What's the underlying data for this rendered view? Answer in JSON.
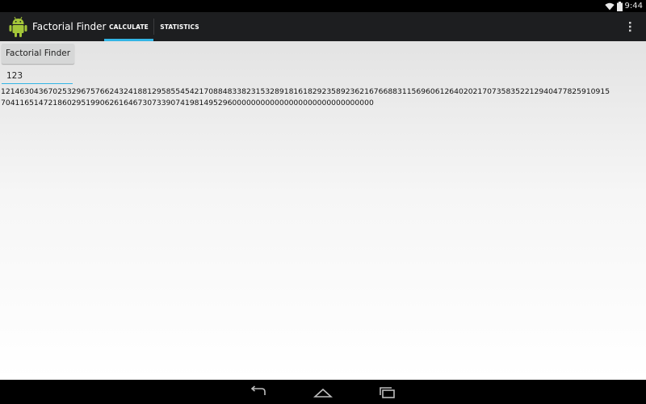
{
  "status_bar": {
    "time": "9:44",
    "icons": [
      "wifi-icon",
      "battery-icon"
    ]
  },
  "action_bar": {
    "app_title": "Factorial Finder",
    "app_icon": "android-icon",
    "tabs": [
      {
        "label": "CALCULATE",
        "selected": true
      },
      {
        "label": "STATISTICS",
        "selected": false
      }
    ],
    "overflow_icon": "overflow-menu-icon",
    "accent_color": "#33b5e5"
  },
  "main": {
    "button_label": "Factorial Finder",
    "input_value": "123",
    "result_line_1": "121463043670253296757662432418812958554542170884833823153289181618292358923621676688311569606126402021707358352212940477825910915",
    "result_line_2": "7041165147218602951990626164673073390741981495296000000000000000000000000000000"
  },
  "nav_bar": {
    "buttons": [
      "back-icon",
      "home-icon",
      "recents-icon"
    ]
  }
}
